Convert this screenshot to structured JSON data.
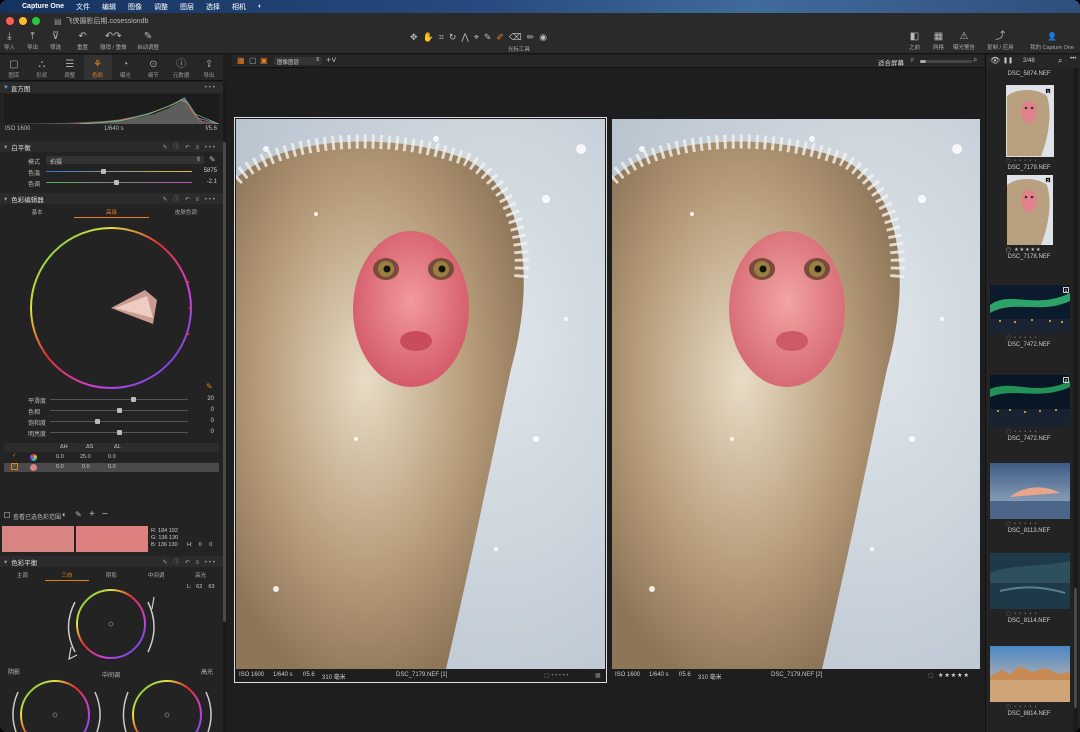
{
  "menubar": {
    "apple": "",
    "app_name": "Capture One",
    "items": [
      "文件",
      "编辑",
      "图像",
      "调整",
      "图层",
      "选择",
      "相机",
      "◐"
    ]
  },
  "window": {
    "title": "飞侠摄影后期.cosessiondb"
  },
  "toolbar": {
    "left": [
      {
        "icon": "import-icon",
        "glyph": "⤓",
        "label": "导入"
      },
      {
        "icon": "export-icon",
        "glyph": "⤒",
        "label": "导出"
      },
      {
        "icon": "filter-icon",
        "glyph": "⊽",
        "label": "筛选"
      },
      {
        "icon": "reset-icon",
        "glyph": "↶",
        "label": "重置"
      },
      {
        "icon": "undo-icon",
        "glyph": "↶↷",
        "label": "撤销 / 重做"
      },
      {
        "icon": "auto-adjust-icon",
        "glyph": "✎",
        "label": "自动调整"
      }
    ],
    "cursor_tools_label": "光标工具",
    "right": [
      {
        "icon": "before-after-icon",
        "glyph": "◧",
        "label": "之前"
      },
      {
        "icon": "grid-icon",
        "glyph": "▦",
        "label": "网格"
      },
      {
        "icon": "exposure-warning-icon",
        "glyph": "⚠",
        "label": "曝光警告"
      },
      {
        "icon": "copy-apply-icon",
        "glyph": "⤴",
        "label": "复制 / 应用"
      },
      {
        "icon": "account-icon",
        "glyph": "👤",
        "label": "我的 Capture One"
      }
    ]
  },
  "left_tabs": [
    {
      "icon": "library-icon",
      "glyph": "▢",
      "label": "图库"
    },
    {
      "icon": "shape-icon",
      "glyph": "⛬",
      "label": "形状"
    },
    {
      "icon": "adjust-icon",
      "glyph": "☰",
      "label": "调整"
    },
    {
      "icon": "color-icon",
      "glyph": "⚘",
      "label": "色彩",
      "active": true
    },
    {
      "icon": "exposure-icon",
      "glyph": "◔",
      "label": "曝光"
    },
    {
      "icon": "details-icon",
      "glyph": "⊙",
      "label": "细节"
    },
    {
      "icon": "metadata-icon",
      "glyph": "ⓘ",
      "label": "元数据"
    },
    {
      "icon": "output-icon",
      "glyph": "⇪",
      "label": "导出"
    }
  ],
  "histogram": {
    "title": "直方图",
    "iso": "ISO 1600",
    "shutter": "1/640 s",
    "aperture": "f/5.6"
  },
  "white_balance": {
    "title": "白平衡",
    "mode_label": "模式",
    "mode_value": "拍摄",
    "temp_label": "色温",
    "temp_value": "5875",
    "tint_label": "色调",
    "tint_value": "-2.1"
  },
  "color_editor": {
    "title": "色彩编辑器",
    "tabs": [
      "基本",
      "高级",
      "皮肤色调"
    ],
    "active_tab": 1,
    "sliders": [
      {
        "label": "平滑度",
        "value": "20",
        "pos": 0.6
      },
      {
        "label": "色相",
        "value": "0",
        "pos": 0.5
      },
      {
        "label": "饱和度",
        "value": "0",
        "pos": 0.34
      },
      {
        "label": "明亮度",
        "value": "0",
        "pos": 0.5
      }
    ],
    "table_headers": [
      "ΔH",
      "ΔS",
      "ΔL"
    ],
    "rows": [
      {
        "h": "0.0",
        "s": "25.0",
        "l": "0.0"
      },
      {
        "h": "0.0",
        "s": "0.0",
        "l": "0.0"
      }
    ],
    "view_range_label": "查看已选色彩范围",
    "readout_left": {
      "r": "R: 184  192",
      "g": "G: 136  130",
      "b": "B: 136  130"
    },
    "readout_right": {
      "h": "H:    0     0",
      "s": "S:   25    32",
      "l": "L:   62    63"
    },
    "swatch_before": "#d88483",
    "swatch_after": "#de7f80"
  },
  "color_balance": {
    "title": "色彩平衡",
    "tabs": [
      "主调",
      "三向",
      "阴影",
      "中间调",
      "高光"
    ],
    "active_tab": 1,
    "shadow_label": "阴影",
    "mid_label": "中间调",
    "highlight_label": "高光"
  },
  "viewer": {
    "top_dropdown": "图像图层",
    "fit_label": "适合屏幕",
    "left_caption": {
      "iso": "ISO 1600",
      "shutter": "1/640 s",
      "aperture": "f/5.6",
      "focal": "310 毫米",
      "file": "DSC_7179.NEF [1]"
    },
    "right_caption": {
      "iso": "ISO 1600",
      "shutter": "1/640 s",
      "aperture": "f/5.6",
      "focal": "310 毫米",
      "file": "DSC_7179.NEF [2]",
      "stars": "★★★★★"
    }
  },
  "filmstrip": {
    "counter": "2/48",
    "items": [
      {
        "file": "DSC_5874.NEF"
      },
      {
        "file": "DSC_7179.NEF",
        "badge": "1"
      },
      {
        "file": "DSC_7178.NEF",
        "badge": "2",
        "stars": "★★★★★"
      },
      {
        "file": "DSC_7472.NEF",
        "badge": "1"
      },
      {
        "file": "DSC_7472.NEF",
        "badge": "2"
      },
      {
        "file": "DSC_8113.NEF"
      },
      {
        "file": "DSC_8114.NEF"
      },
      {
        "file": "DSC_8814.NEF"
      }
    ]
  }
}
